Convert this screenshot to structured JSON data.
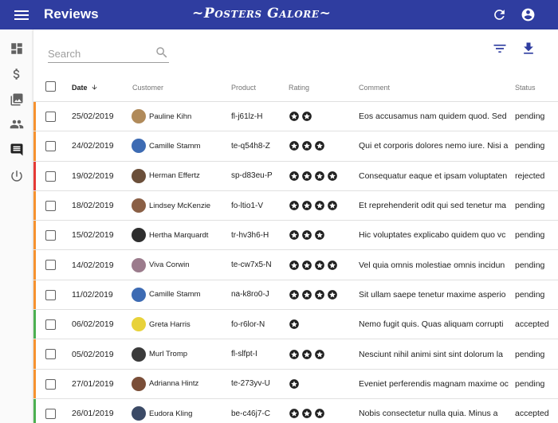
{
  "app": {
    "title": "Reviews",
    "brand": "~Posters Galore~"
  },
  "toolbar": {
    "search_placeholder": "Search"
  },
  "colors": {
    "appbar": "#2f3da0",
    "accent": "#2f3da0",
    "pending": "#f6922f",
    "accepted": "#4caf50",
    "rejected": "#e53935"
  },
  "sidebar": {
    "items": [
      {
        "icon": "dashboard-icon"
      },
      {
        "icon": "dollar-icon"
      },
      {
        "icon": "posters-icon"
      },
      {
        "icon": "customers-icon"
      },
      {
        "icon": "reviews-icon",
        "active": true
      },
      {
        "icon": "logout-icon"
      }
    ]
  },
  "table": {
    "headers": {
      "date": "Date",
      "customer": "Customer",
      "product": "Product",
      "rating": "Rating",
      "comment": "Comment",
      "status": "Status"
    },
    "rows": [
      {
        "date": "25/02/2019",
        "customer": "Pauline Kihn",
        "product": "fl-j61lz-H",
        "rating": 2,
        "comment": "Eos accusamus nam quidem quod. Sed",
        "status": "pending",
        "avatar_color": "#b08a5a"
      },
      {
        "date": "24/02/2019",
        "customer": "Camille Stamm",
        "product": "te-q54h8-Z",
        "rating": 3,
        "comment": "Qui et corporis dolores nemo iure. Nisi a",
        "status": "pending",
        "avatar_color": "#3d6bb3"
      },
      {
        "date": "19/02/2019",
        "customer": "Herman Effertz",
        "product": "sp-d83eu-P",
        "rating": 4,
        "comment": "Consequatur eaque et ipsam voluptaten",
        "status": "rejected",
        "avatar_color": "#6b4f3a"
      },
      {
        "date": "18/02/2019",
        "customer": "Lindsey McKenzie",
        "product": "fo-ltio1-V",
        "rating": 4,
        "comment": "Et reprehenderit odit qui sed tenetur ma",
        "status": "pending",
        "avatar_color": "#8a5f45"
      },
      {
        "date": "15/02/2019",
        "customer": "Hertha Marquardt",
        "product": "tr-hv3h6-H",
        "rating": 3,
        "comment": "Hic voluptates explicabo quidem quo vc",
        "status": "pending",
        "avatar_color": "#2e2e2e"
      },
      {
        "date": "14/02/2019",
        "customer": "Viva Corwin",
        "product": "te-cw7x5-N",
        "rating": 4,
        "comment": "Vel quia omnis molestiae omnis incidun",
        "status": "pending",
        "avatar_color": "#9b7b8c"
      },
      {
        "date": "11/02/2019",
        "customer": "Camille Stamm",
        "product": "na-k8ro0-J",
        "rating": 4,
        "comment": "Sit ullam saepe tenetur maxime asperio",
        "status": "pending",
        "avatar_color": "#3d6bb3"
      },
      {
        "date": "06/02/2019",
        "customer": "Greta Harris",
        "product": "fo-r6lor-N",
        "rating": 1,
        "comment": "Nemo fugit quis. Quas aliquam corrupti",
        "status": "accepted",
        "avatar_color": "#e8d23a"
      },
      {
        "date": "05/02/2019",
        "customer": "Murl Tromp",
        "product": "fl-slfpt-I",
        "rating": 3,
        "comment": "Nesciunt nihil animi sint sint dolorum la",
        "status": "pending",
        "avatar_color": "#3a3a3a"
      },
      {
        "date": "27/01/2019",
        "customer": "Adrianna Hintz",
        "product": "te-273yv-U",
        "rating": 1,
        "comment": "Eveniet perferendis magnam maxime oc",
        "status": "pending",
        "avatar_color": "#7a4e38"
      },
      {
        "date": "26/01/2019",
        "customer": "Eudora Kling",
        "product": "be-c46j7-C",
        "rating": 3,
        "comment": "Nobis consectetur nulla quia. Minus a",
        "status": "accepted",
        "avatar_color": "#3b4a66"
      }
    ]
  }
}
